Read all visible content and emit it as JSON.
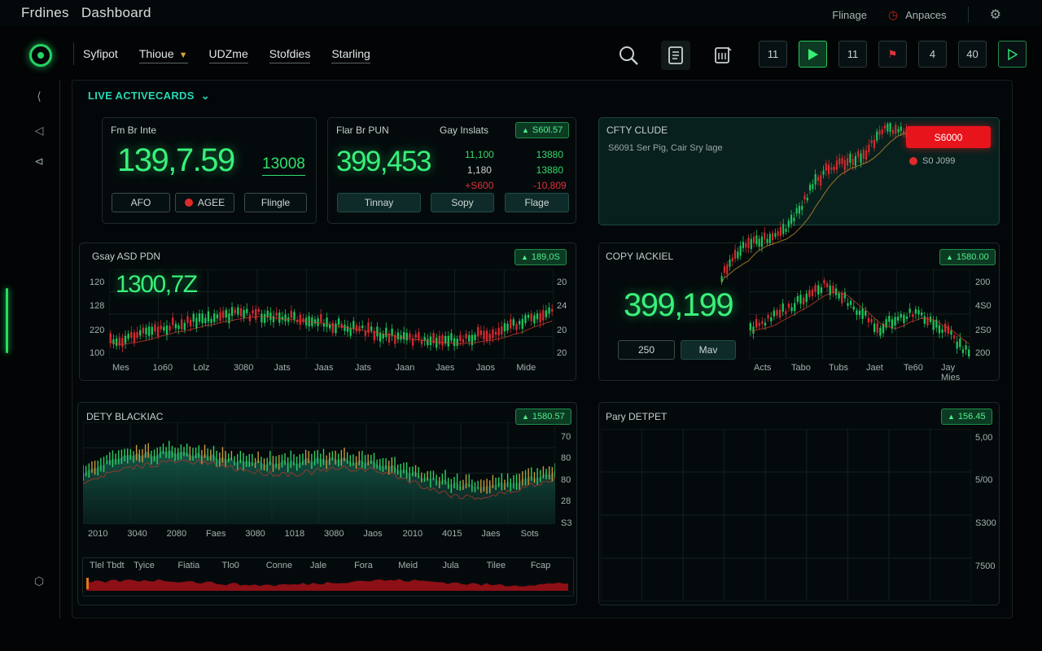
{
  "app": {
    "title": "Frdines",
    "subtitle": "Dashboard"
  },
  "top_right": {
    "finance": "Flinage",
    "workspaces": "Anpaces"
  },
  "nav": {
    "items": [
      "Syfipot",
      "Thioue",
      "UDZme",
      "Stofdies",
      "Starling"
    ]
  },
  "controls": [
    "11",
    "11",
    "4",
    "40"
  ],
  "section": {
    "title": "LIVE ACTIVECARDS"
  },
  "card1": {
    "title": "Fm Br Inte",
    "big": "139,7.59",
    "small": "13008",
    "btns": [
      "AFO",
      "AGEE",
      "Flingle"
    ]
  },
  "card2": {
    "title": "Flar Br PUN",
    "big": "399,453",
    "col_title": "Gay Inslats",
    "pill": "S60l.57",
    "col1": [
      "11,100",
      "1,180",
      "+S600"
    ],
    "col2": [
      "13880",
      "13880",
      "-10,809"
    ],
    "btns": [
      "Tinnay",
      "Sopy",
      "Flage"
    ]
  },
  "card3": {
    "title": "CFTY CLUDE",
    "subtitle": "S6091 Ser Pig, Cair Sry lage",
    "red_badge": "S6000",
    "legend": "S0 J099"
  },
  "chart1": {
    "title": "Gsay ASD PDN",
    "big": "1300,7Z",
    "pill": "189,0S",
    "yleft": [
      "120",
      "128",
      "220",
      "100"
    ],
    "yright": [
      "20",
      "24",
      "20",
      "20"
    ],
    "xlabels": [
      "Mes",
      "1o60",
      "Lolz",
      "3080",
      "Jats",
      "Jaas",
      "Jats",
      "Jaan",
      "Jaes",
      "Jaos",
      "Mide"
    ]
  },
  "chart2": {
    "title": "COPY IACKIEL",
    "big": "399,199",
    "pill": "1580.00",
    "btns": [
      "250",
      "Mav"
    ],
    "yright": [
      "200",
      "4S0",
      "2S0",
      "200"
    ],
    "xlabels": [
      "Acts",
      "Tabo",
      "Tubs",
      "Jaet",
      "Te60",
      "Jay Mies"
    ]
  },
  "chart3": {
    "title": "DETY BLACKIAC",
    "pill": "1580.57",
    "yright": [
      "70",
      "80",
      "80",
      "28",
      "S3"
    ],
    "xlabels": [
      "2010",
      "3040",
      "2080",
      "Faes",
      "3080",
      "1018",
      "3080",
      "Jaos",
      "2010",
      "4015",
      "Jaes",
      "Sots"
    ],
    "bottom_labels": [
      "Tlel Tbdt",
      "Tyice",
      "Fiatia",
      "Tlo0",
      "Conne",
      "Jale",
      "Fora",
      "Meid",
      "Jula",
      "Tilee",
      "Fcap"
    ]
  },
  "chart4": {
    "title": "Pary DETPET",
    "pill": "156.45",
    "yright": [
      "5,00",
      "5/00",
      "S300",
      "7500"
    ]
  },
  "colors": {
    "green": "#39f07a",
    "red": "#e0303a",
    "teal": "#28d6b4",
    "bg": "#020405"
  },
  "icons": [
    "search-icon",
    "document-icon",
    "calculator-icon",
    "play-icon",
    "share-icon",
    "settings-icon"
  ]
}
